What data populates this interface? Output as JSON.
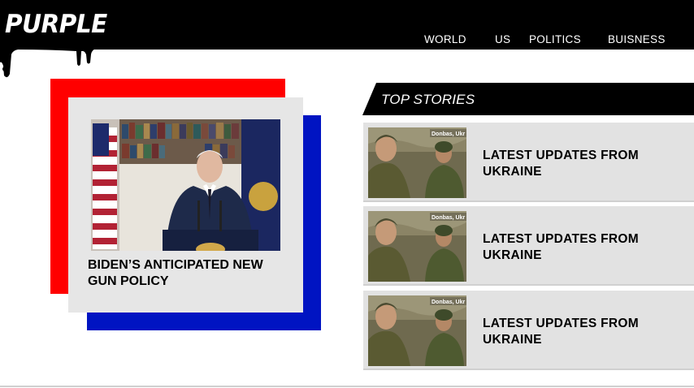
{
  "header": {
    "logo": "PURPLE",
    "nav": [
      "WORLD",
      "US",
      "POLITICS",
      "BUISNESS"
    ]
  },
  "feature": {
    "title": "BIDEN’S ANTICIPATED NEW GUN POLICY"
  },
  "top_stories": {
    "label": "TOP STORIES",
    "items": [
      {
        "title": "LATEST UPDATES FROM UKRAINE",
        "thumb_caption": "Donbas, Ukr"
      },
      {
        "title": "LATEST UPDATES FROM UKRAINE",
        "thumb_caption": "Donbas, Ukr"
      },
      {
        "title": "LATEST UPDATES FROM UKRAINE",
        "thumb_caption": "Donbas, Ukr"
      }
    ]
  },
  "colors": {
    "header_bg": "#000000",
    "accent_red": "#ff0000",
    "accent_blue": "#0014c2",
    "card_gray": "#e6e6e6",
    "story_gray": "#e2e2e2"
  }
}
